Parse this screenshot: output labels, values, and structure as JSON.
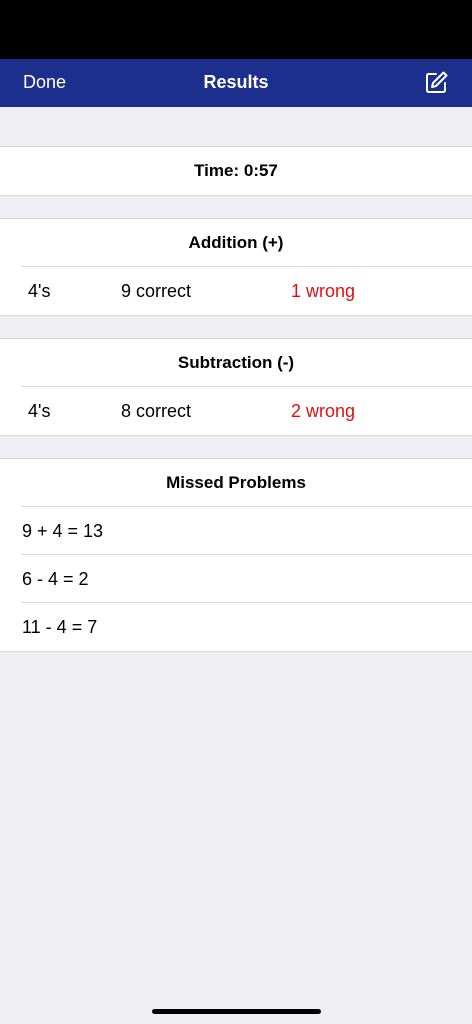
{
  "nav": {
    "done_label": "Done",
    "title": "Results",
    "edit_icon": "compose-icon"
  },
  "time": {
    "label": "Time: 0:57"
  },
  "addition": {
    "header": "Addition (+)",
    "level": "4's",
    "correct": "9 correct",
    "wrong": "1 wrong"
  },
  "subtraction": {
    "header": "Subtraction (-)",
    "level": "4's",
    "correct": "8 correct",
    "wrong": "2 wrong"
  },
  "missed": {
    "header": "Missed Problems",
    "problems": [
      "9 + 4 = 13",
      "6 - 4 = 2",
      "11 - 4 = 7"
    ]
  },
  "colors": {
    "nav_background": "#1d2f8c",
    "wrong_text": "#e00f0f",
    "page_background": "#efeff4"
  }
}
